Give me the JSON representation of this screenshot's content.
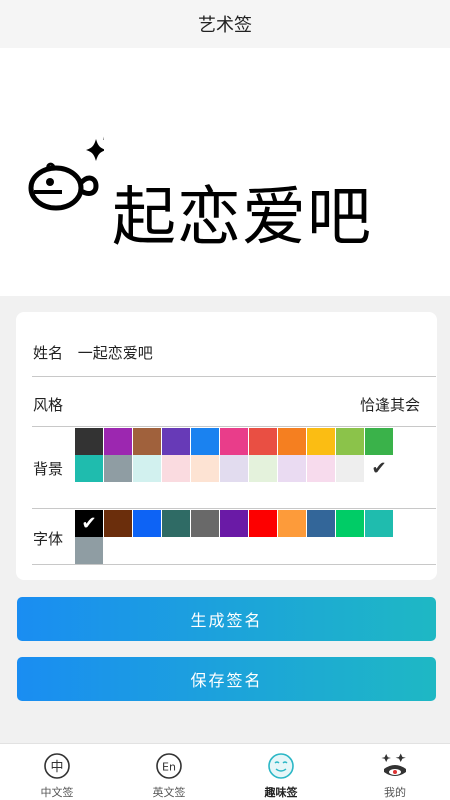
{
  "header": {
    "title": "艺术签"
  },
  "preview": {
    "text": "起恋爱吧"
  },
  "form": {
    "name_label": "姓名",
    "name_value": "一起恋爱吧",
    "style_label": "风格",
    "style_value": "恰逢其会",
    "background_label": "背景",
    "font_label": "字体"
  },
  "background_colors": [
    "#333333",
    "#9c27b0",
    "#a0613c",
    "#673ab7",
    "#1a82f0",
    "#e93d8a",
    "#e94f43",
    "#f57f20",
    "#fbbd13",
    "#8bc34a",
    "#3ab24a",
    "#1fbcae",
    "#8f9da3",
    "#d2f1ef",
    "#fadbe0",
    "#fde3d3",
    "#e2dcef",
    "#e4f2dc",
    "#eadbf2",
    "#f7dbed",
    "#eeeeee",
    "#ffffff"
  ],
  "background_selected": 21,
  "font_colors": [
    "#000000",
    "#6b2e0c",
    "#0d63f5",
    "#2f6b65",
    "#696969",
    "#6a1aa6",
    "#fd0000",
    "#fd9b3a",
    "#336699",
    "#00cc66",
    "#1fbcae",
    "#8f9da3"
  ],
  "font_selected": 0,
  "buttons": {
    "generate": "生成签名",
    "save": "保存签名"
  },
  "tabs": [
    {
      "label": "中文签",
      "icon": "中"
    },
    {
      "label": "英文签",
      "icon": "En"
    },
    {
      "label": "趣味签",
      "icon": "face"
    },
    {
      "label": "我的",
      "icon": "profile"
    }
  ]
}
